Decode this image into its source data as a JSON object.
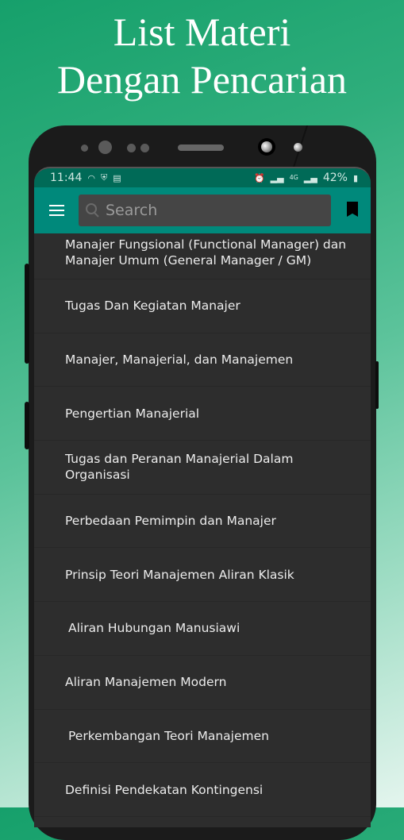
{
  "promo": {
    "title_line1": "List Materi",
    "title_line2": "Dengan Pencarian"
  },
  "statusbar": {
    "time": "11:44",
    "left_icons": [
      "cloud-icon",
      "shield-icon",
      "wifi-icon"
    ],
    "right_icons": [
      "alarm-icon",
      "signal-icon",
      "4g-icon",
      "signal-icon"
    ],
    "battery": "42%"
  },
  "appbar": {
    "menu_icon": "hamburger-menu-icon",
    "search_placeholder": "Search",
    "search_value": "",
    "bookmark_icon": "bookmark-icon"
  },
  "list": {
    "items": [
      {
        "label": "Manajer Fungsional (Functional Manager) dan Manajer Umum (General Manager / GM)"
      },
      {
        "label": "Tugas Dan Kegiatan Manajer"
      },
      {
        "label": "Manajer, Manajerial, dan Manajemen"
      },
      {
        "label": "Pengertian Manajerial"
      },
      {
        "label": "Tugas dan Peranan Manajerial Dalam Organisasi"
      },
      {
        "label": "Perbedaan Pemimpin dan Manajer"
      },
      {
        "label": "Prinsip Teori Manajemen Aliran Klasik"
      },
      {
        "label": "Aliran Hubungan Manusiawi"
      },
      {
        "label": "Aliran Manajemen Modern"
      },
      {
        "label": "Perkembangan Teori Manajemen"
      },
      {
        "label": "Definisi Pendekatan Kontingensi"
      }
    ]
  },
  "colors": {
    "appbar": "#00897b",
    "statusbar": "#006a57",
    "list_background": "#2d2d2d",
    "list_text": "#ececec"
  }
}
